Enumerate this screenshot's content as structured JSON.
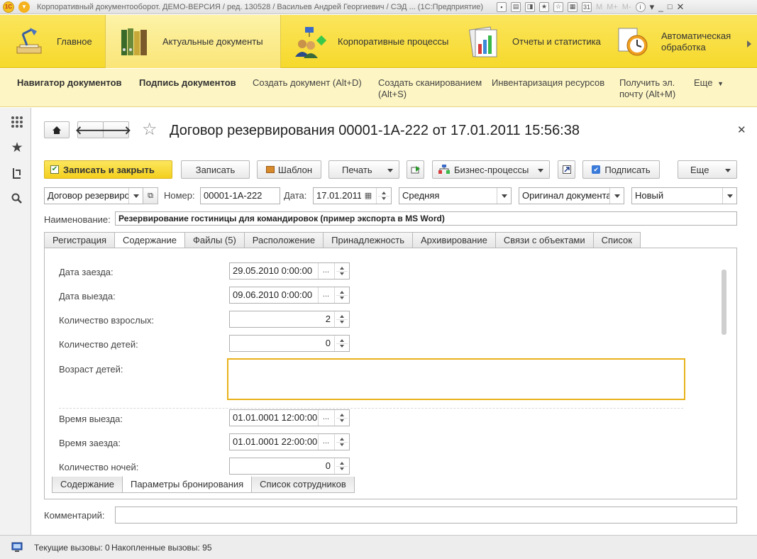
{
  "window": {
    "title": "Корпоративный документооборот. ДЕМО-ВЕРСИЯ / ред. 130528 /  Васильев Андрей Георгиевич / СЭД ...  (1С:Предприятие)",
    "m_buttons": [
      "M",
      "M+",
      "M-"
    ]
  },
  "sections": [
    {
      "label": "Главное",
      "icon": "desk-lamp-icon"
    },
    {
      "label": "Актуальные документы",
      "icon": "binders-icon"
    },
    {
      "label": "Корпоративные процессы",
      "icon": "people-process-icon"
    },
    {
      "label": "Отчеты и статистика",
      "icon": "reports-icon"
    },
    {
      "label": "Автоматическая обработка",
      "icon": "clock-gear-icon"
    }
  ],
  "commands": [
    "Навигатор документов",
    "Подпись документов",
    "Создать документ (Alt+D)",
    "Создать сканированием (Alt+S)",
    "Инвентаризация ресурсов",
    "Получить эл. почту (Alt+M)",
    "Еще"
  ],
  "form": {
    "title": "Договор резервирования 00001-1А-222 от 17.01.2011 15:56:38",
    "buttons": {
      "save_close": "Записать и закрыть",
      "save": "Записать",
      "template": "Шаблон",
      "print": "Печать",
      "business_processes": "Бизнес-процессы",
      "sign": "Подписать",
      "more": "Еще"
    },
    "doc_type": "Договор резервирования",
    "number_label": "Номер:",
    "number": "00001-1А-222",
    "date_label": "Дата:",
    "date": "17.01.2011",
    "importance": "Средняя",
    "original": "Оригинал документа",
    "state": "Новый",
    "name_label": "Наименование:",
    "name": "Резервирование гостиницы для командировок (пример экспорта в MS Word)",
    "tabs": [
      "Регистрация",
      "Содержание",
      "Файлы (5)",
      "Расположение",
      "Принадлежность",
      "Архивирование",
      "Связи с объектами",
      "Список"
    ],
    "active_tab": "Содержание",
    "params": {
      "checkin_label": "Дата заезда:",
      "checkin": "29.05.2010  0:00:00",
      "checkout_label": "Дата выезда:",
      "checkout": "09.06.2010  0:00:00",
      "adults_label": "Количество взрослых:",
      "adults": "2",
      "children_label": "Количество детей:",
      "children": "0",
      "children_age_label": "Возраст детей:",
      "children_age": "",
      "checkout_time_label": "Время выезда:",
      "checkout_time": "01.01.0001 12:00:00",
      "checkin_time_label": "Время заезда:",
      "checkin_time": "01.01.0001 22:00:00",
      "nights_label": "Количество ночей:",
      "nights": "0"
    },
    "subtabs": [
      "Содержание",
      "Параметры бронирования",
      "Список сотрудников"
    ],
    "active_subtab": "Параметры бронирования",
    "comment_label": "Комментарий:",
    "comment": ""
  },
  "status": {
    "current_calls": "Текущие вызовы: 0",
    "accumulated_calls": "Накопленные вызовы: 95"
  },
  "colors": {
    "sections_bg": "#f6d92c",
    "commands_bg": "#fdf5c3",
    "primary_button": "#f3cf1d",
    "focus_border": "#e8b21a"
  }
}
